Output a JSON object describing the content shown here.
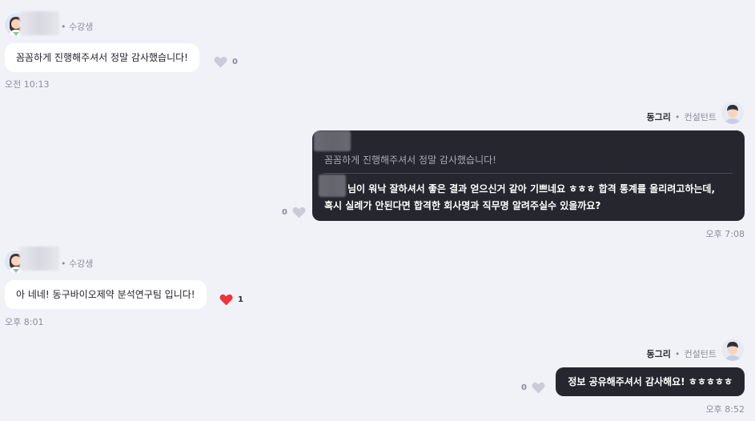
{
  "messages": [
    {
      "role": "수강생",
      "text": "꼼꼼하게 진행해주셔서 정말 감사했습니다!",
      "likes": "0",
      "time": "오전 10:13"
    },
    {
      "name": "동그리",
      "role": "컨설턴트",
      "quote": "꼼꼼하게 진행해주셔서 정말 감사했습니다!",
      "reply_line1": "님이 워낙 잘하셔서 좋은 결과 얻으신거 같아 기쁘네요 ㅎㅎㅎ 합격 통계를 올리려고하는데,",
      "reply_line2": "혹시 실례가 안된다면 합격한 회사명과 직무명 알려주실수 있을까요?",
      "likes": "0",
      "time": "오후 7:08"
    },
    {
      "role": "수강생",
      "text": "아 네네! 동구바이오제약 분석연구팀 입니다!",
      "likes": "1",
      "time": "오후 8:01"
    },
    {
      "name": "동그리",
      "role": "컨설턴트",
      "text": "정보 공유해주셔서 감사해요! ㅎㅎㅎㅎㅎ",
      "likes": "0",
      "time": "오후 8:52"
    }
  ],
  "colors": {
    "background": "#f1f2f8",
    "bubble_dark": "#26262f",
    "heart_active": "#f0323c",
    "heart_inactive": "#c9ccd8"
  }
}
